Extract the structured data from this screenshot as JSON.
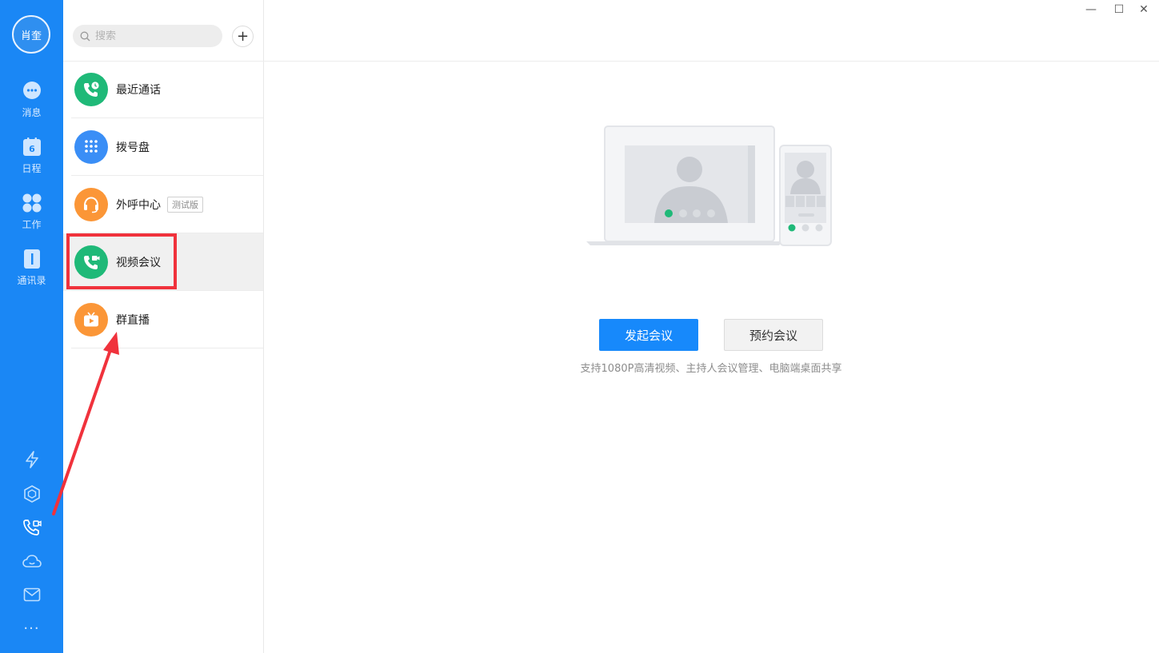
{
  "user": {
    "avatar_text": "肖奎"
  },
  "rail": {
    "items": [
      {
        "label": "消息",
        "icon": "chat-icon"
      },
      {
        "label": "日程",
        "icon": "calendar-icon",
        "badge": "6"
      },
      {
        "label": "工作",
        "icon": "apps-grid-icon"
      },
      {
        "label": "通讯录",
        "icon": "address-book-icon"
      }
    ],
    "bottom_icons": [
      "lightning-icon",
      "cube-icon",
      "video-call-icon",
      "cloud-icon",
      "mail-icon",
      "more-icon"
    ],
    "more_text": "···"
  },
  "search": {
    "placeholder": "搜索",
    "add": "+"
  },
  "list": [
    {
      "label": "最近通话",
      "color": "#1fb978"
    },
    {
      "label": "拨号盘",
      "color": "#3a8ef6"
    },
    {
      "label": "外呼中心",
      "tag": "测试版",
      "color": "#fb9637"
    },
    {
      "label": "视频会议",
      "color": "#1fb978",
      "selected": true
    },
    {
      "label": "群直播",
      "color": "#fb9637"
    }
  ],
  "window": {
    "minimize": "—",
    "maximize": "☐",
    "close": "✕"
  },
  "main": {
    "start_meeting": "发起会议",
    "schedule_meeting": "预约会议",
    "description": "支持1080P高清视频、主持人会议管理、电脑端桌面共享"
  },
  "colors": {
    "rail_blue": "#1a87f5",
    "primary": "#1789fb",
    "annotation_red": "#f0323c"
  }
}
